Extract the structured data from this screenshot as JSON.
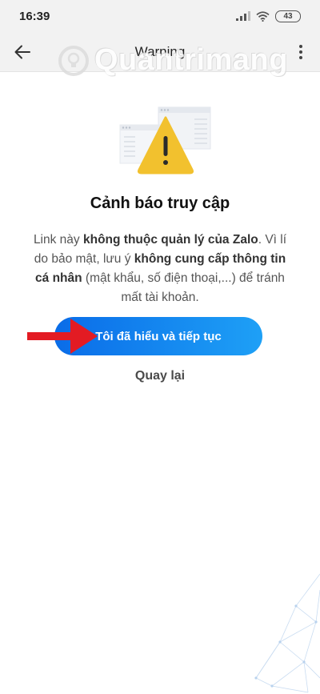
{
  "status_bar": {
    "time": "16:39",
    "battery": "43"
  },
  "app_bar": {
    "title": "Warning"
  },
  "watermark": {
    "text": "Quantrimang"
  },
  "warning": {
    "heading": "Cảnh báo truy cập",
    "message_parts": [
      "Link này ",
      "không thuộc quản lý của Zalo",
      ". Vì lí do bảo mật, lưu ý ",
      "không cung cấp thông tin cá nhân",
      " (mật khẩu, số điện thoại,...) để tránh mất tài khoản."
    ]
  },
  "actions": {
    "continue_label": "Tôi đã hiểu và tiếp tục",
    "back_label": "Quay lại"
  },
  "colors": {
    "accent_start": "#0a6ce8",
    "accent_end": "#1ea0f6",
    "warning_yellow": "#f2c12e",
    "annotation_red": "#e31b23"
  },
  "icons": {
    "back": "arrow-left-icon",
    "more": "more-vertical-icon",
    "warning": "warning-triangle-icon",
    "signal": "signal-icon",
    "wifi": "wifi-icon",
    "battery": "battery-icon"
  }
}
